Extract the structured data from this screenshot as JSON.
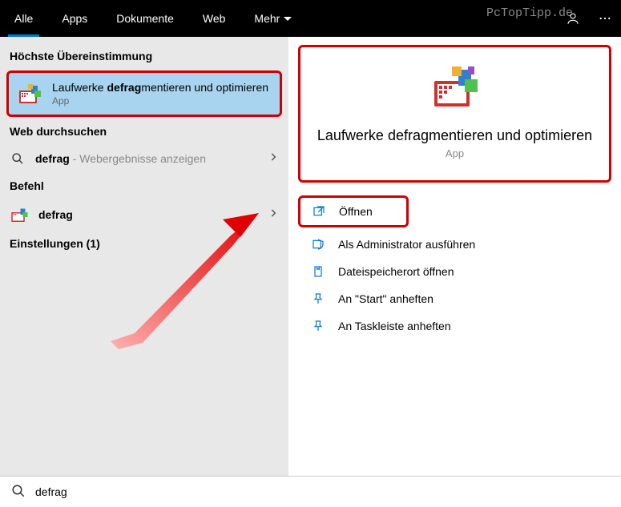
{
  "header": {
    "tabs": {
      "all": "Alle",
      "apps": "Apps",
      "documents": "Dokumente",
      "web": "Web",
      "more": "Mehr"
    },
    "watermark": "PcTopTipp.de"
  },
  "left": {
    "best_match_header": "Höchste Übereinstimmung",
    "best_match": {
      "title_pre": "Laufwerke ",
      "title_bold": "defrag",
      "title_post": "mentieren und optimieren",
      "subtitle": "App"
    },
    "web_header": "Web durchsuchen",
    "web_item": {
      "query": "defrag",
      "hint": " - Webergebnisse anzeigen"
    },
    "command_header": "Befehl",
    "command_item": {
      "label": "defrag"
    },
    "settings_header": "Einstellungen (1)"
  },
  "right": {
    "title": "Laufwerke defragmentieren und optimieren",
    "subtitle": "App",
    "actions": {
      "open": "Öffnen",
      "run_admin": "Als Administrator ausführen",
      "open_location": "Dateispeicherort öffnen",
      "pin_start": "An \"Start\" anheften",
      "pin_taskbar": "An Taskleiste anheften"
    }
  },
  "search": {
    "value": "defrag"
  }
}
